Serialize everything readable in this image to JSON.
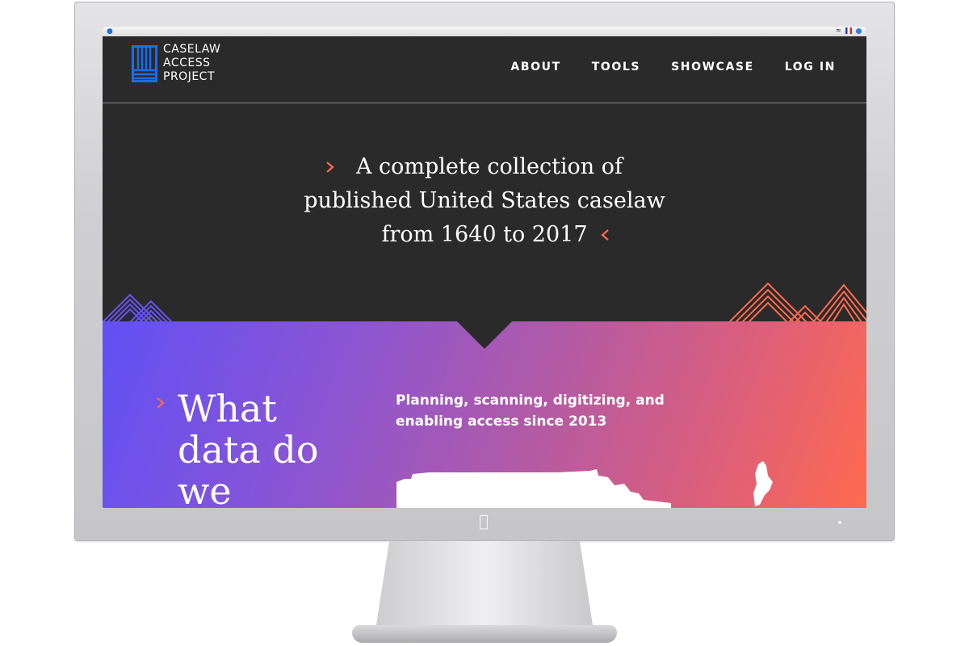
{
  "site": {
    "logo_text": "CASELAW\nACCESS\nPROJECT",
    "nav": [
      "ABOUT",
      "TOOLS",
      "SHOWCASE",
      "LOG IN"
    ]
  },
  "hero": {
    "lines": [
      "A complete collection of",
      "published United States caselaw",
      "from 1640 to 2017"
    ]
  },
  "section": {
    "title": "What data do we",
    "tagline": "Planning, scanning, digitizing, and enabling access since 2013"
  },
  "colors": {
    "background_dark": "#2a2a2a",
    "accent_orange": "#ff6a4f",
    "accent_purple": "#6150f5",
    "logo_blue": "#1a6cf0"
  },
  "icons": [
    "apple-logo-icon",
    "wifi-icon",
    "flag-icon",
    "status-dot-icon",
    "chevron-right-icon",
    "chevron-left-icon"
  ]
}
